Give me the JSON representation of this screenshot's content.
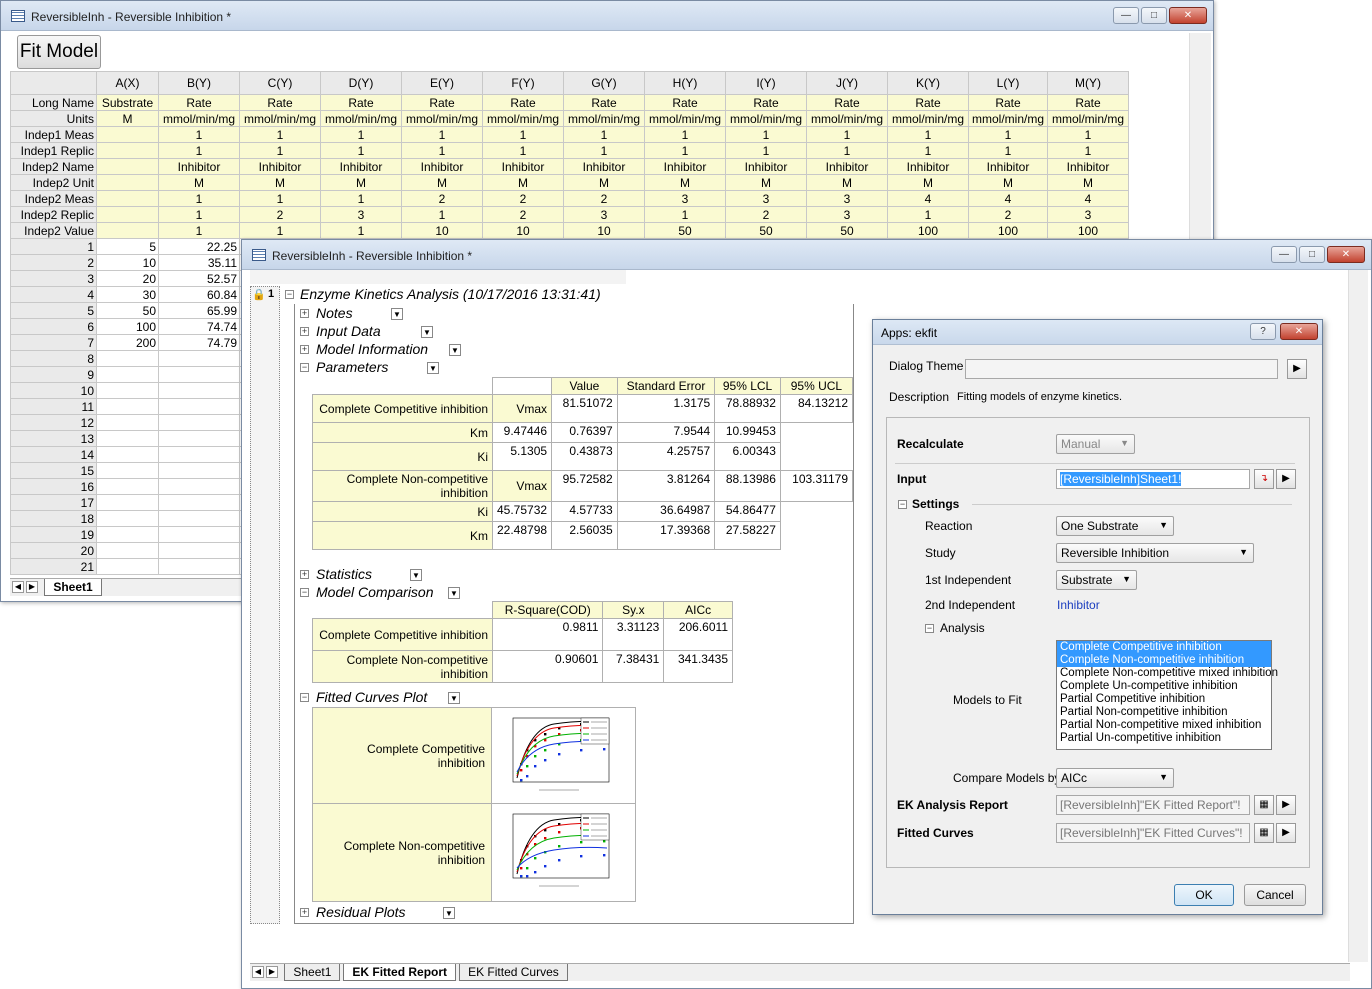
{
  "wks": {
    "title": "ReversibleInh - Reversible Inhibition *",
    "fit_button": "Fit Model",
    "row_labels": [
      "Long Name",
      "Units",
      "Indep1 Meas",
      "Indep1 Replic",
      "Indep2 Name",
      "Indep2 Unit",
      "Indep2 Meas",
      "Indep2 Replic",
      "Indep2 Value"
    ],
    "columns": [
      {
        "h": "A(X)",
        "v": [
          "Substrate",
          "M",
          "",
          "",
          "",
          "",
          "",
          "",
          ""
        ]
      },
      {
        "h": "B(Y)",
        "v": [
          "Rate",
          "mmol/min/mg",
          "1",
          "1",
          "Inhibitor",
          "M",
          "1",
          "1",
          "1"
        ]
      },
      {
        "h": "C(Y)",
        "v": [
          "Rate",
          "mmol/min/mg",
          "1",
          "1",
          "Inhibitor",
          "M",
          "1",
          "2",
          "1"
        ]
      },
      {
        "h": "D(Y)",
        "v": [
          "Rate",
          "mmol/min/mg",
          "1",
          "1",
          "Inhibitor",
          "M",
          "1",
          "3",
          "1"
        ]
      },
      {
        "h": "E(Y)",
        "v": [
          "Rate",
          "mmol/min/mg",
          "1",
          "1",
          "Inhibitor",
          "M",
          "2",
          "1",
          "10"
        ]
      },
      {
        "h": "F(Y)",
        "v": [
          "Rate",
          "mmol/min/mg",
          "1",
          "1",
          "Inhibitor",
          "M",
          "2",
          "2",
          "10"
        ]
      },
      {
        "h": "G(Y)",
        "v": [
          "Rate",
          "mmol/min/mg",
          "1",
          "1",
          "Inhibitor",
          "M",
          "2",
          "3",
          "10"
        ]
      },
      {
        "h": "H(Y)",
        "v": [
          "Rate",
          "mmol/min/mg",
          "1",
          "1",
          "Inhibitor",
          "M",
          "3",
          "1",
          "50"
        ]
      },
      {
        "h": "I(Y)",
        "v": [
          "Rate",
          "mmol/min/mg",
          "1",
          "1",
          "Inhibitor",
          "M",
          "3",
          "2",
          "50"
        ]
      },
      {
        "h": "J(Y)",
        "v": [
          "Rate",
          "mmol/min/mg",
          "1",
          "1",
          "Inhibitor",
          "M",
          "3",
          "3",
          "50"
        ]
      },
      {
        "h": "K(Y)",
        "v": [
          "Rate",
          "mmol/min/mg",
          "1",
          "1",
          "Inhibitor",
          "M",
          "4",
          "1",
          "100"
        ]
      },
      {
        "h": "L(Y)",
        "v": [
          "Rate",
          "mmol/min/mg",
          "1",
          "1",
          "Inhibitor",
          "M",
          "4",
          "2",
          "100"
        ]
      },
      {
        "h": "M(Y)",
        "v": [
          "Rate",
          "mmol/min/mg",
          "1",
          "1",
          "Inhibitor",
          "M",
          "4",
          "3",
          "100"
        ]
      }
    ],
    "data_rows": [
      [
        "1",
        "5",
        "22.25"
      ],
      [
        "2",
        "10",
        "35.11"
      ],
      [
        "3",
        "20",
        "52.57"
      ],
      [
        "4",
        "30",
        "60.84"
      ],
      [
        "5",
        "50",
        "65.99"
      ],
      [
        "6",
        "100",
        "74.74"
      ],
      [
        "7",
        "200",
        "74.79"
      ],
      [
        "8",
        "",
        ""
      ],
      [
        "9",
        "",
        ""
      ],
      [
        "10",
        "",
        ""
      ],
      [
        "11",
        "",
        ""
      ],
      [
        "12",
        "",
        ""
      ],
      [
        "13",
        "",
        ""
      ],
      [
        "14",
        "",
        ""
      ],
      [
        "15",
        "",
        ""
      ],
      [
        "16",
        "",
        ""
      ],
      [
        "17",
        "",
        ""
      ],
      [
        "18",
        "",
        ""
      ],
      [
        "19",
        "",
        ""
      ],
      [
        "20",
        "",
        ""
      ],
      [
        "21",
        "",
        ""
      ]
    ],
    "sheet_tab": "Sheet1"
  },
  "report": {
    "title": "ReversibleInh - Reversible Inhibition *",
    "root_index": "1",
    "root_title": "Enzyme Kinetics Analysis (10/17/2016 13:31:41)",
    "nodes": {
      "notes": "Notes",
      "input": "Input Data",
      "model_info": "Model Information",
      "params": "Parameters",
      "stats": "Statistics",
      "compare": "Model Comparison",
      "fitted": "Fitted Curves Plot",
      "residual": "Residual Plots"
    },
    "param_headers": [
      "Value",
      "Standard Error",
      "95% LCL",
      "95% UCL"
    ],
    "param_groups": [
      {
        "label": "Complete Competitive inhibition",
        "rows": [
          [
            "Vmax",
            "81.51072",
            "1.3175",
            "78.88932",
            "84.13212"
          ],
          [
            "Km",
            "9.47446",
            "0.76397",
            "7.9544",
            "10.99453"
          ],
          [
            "Ki",
            "5.1305",
            "0.43873",
            "4.25757",
            "6.00343"
          ]
        ]
      },
      {
        "label": "Complete Non-competitive inhibition",
        "rows": [
          [
            "Vmax",
            "95.72582",
            "3.81264",
            "88.13986",
            "103.31179"
          ],
          [
            "Ki",
            "45.75732",
            "4.57733",
            "36.64987",
            "54.86477"
          ],
          [
            "Km",
            "22.48798",
            "2.56035",
            "17.39368",
            "27.58227"
          ]
        ]
      }
    ],
    "compare_headers": [
      "R-Square(COD)",
      "Sy.x",
      "AICc"
    ],
    "compare_rows": [
      {
        "label": "Complete Competitive inhibition",
        "vals": [
          "0.9811",
          "3.31123",
          "206.6011"
        ]
      },
      {
        "label": "Complete Non-competitive inhibition",
        "vals": [
          "0.90601",
          "7.38431",
          "341.3435"
        ]
      }
    ],
    "plot_labels": [
      "Complete Competitive inhibition",
      "Complete Non-competitive inhibition"
    ],
    "plot_series_colors": [
      "#000000",
      "#e00000",
      "#00b000",
      "#1030e0"
    ],
    "tabs": [
      "Sheet1",
      "EK Fitted Report",
      "EK Fitted Curves"
    ]
  },
  "dialog": {
    "title": "Apps: ekfit",
    "help": "?",
    "dialog_theme_label": "Dialog Theme",
    "dialog_theme_value": "",
    "description_label": "Description",
    "description_value": "Fitting models of enzyme kinetics.",
    "recalculate_label": "Recalculate",
    "recalculate_value": "Manual",
    "input_label": "Input",
    "input_value": "[ReversibleInh]Sheet1!",
    "settings_label": "Settings",
    "reaction_label": "Reaction",
    "reaction_value": "One Substrate",
    "study_label": "Study",
    "study_value": "Reversible Inhibition",
    "indep1_label": "1st Independent",
    "indep1_value": "Substrate",
    "indep2_label": "2nd Independent",
    "indep2_value": "Inhibitor",
    "analysis_label": "Analysis",
    "models_label": "Models to Fit",
    "models": [
      {
        "name": "Complete Competitive inhibition",
        "selected": true
      },
      {
        "name": "Complete Non-competitive inhibition",
        "selected": true
      },
      {
        "name": "Complete Non-competitive mixed inhibition",
        "selected": false
      },
      {
        "name": "Complete Un-competitive inhibition",
        "selected": false
      },
      {
        "name": "Partial Competitive inhibition",
        "selected": false
      },
      {
        "name": "Partial Non-competitive inhibition",
        "selected": false
      },
      {
        "name": "Partial Non-competitive mixed inhibition",
        "selected": false
      },
      {
        "name": "Partial Un-competitive inhibition",
        "selected": false
      }
    ],
    "compare_label": "Compare Models by",
    "compare_value": "AICc",
    "report_label": "EK Analysis Report",
    "report_value": "[ReversibleInh]\"EK Fitted Report\"!",
    "curves_label": "Fitted Curves",
    "curves_value": "[ReversibleInh]\"EK Fitted Curves\"!",
    "ok": "OK",
    "cancel": "Cancel"
  }
}
